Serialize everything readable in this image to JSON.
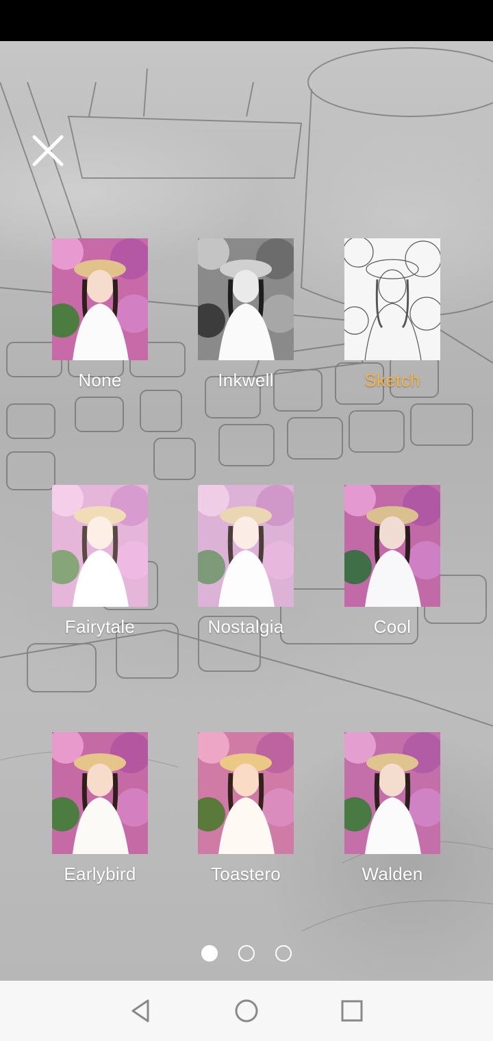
{
  "screen": {
    "close_icon": "close-icon",
    "selected_color": "#f4b541"
  },
  "filters": [
    {
      "label": "None",
      "style": "color",
      "selected": false
    },
    {
      "label": "Inkwell",
      "style": "bw",
      "selected": false
    },
    {
      "label": "Sketch",
      "style": "sketch",
      "selected": true
    },
    {
      "label": "Fairytale",
      "style": "soft",
      "selected": false
    },
    {
      "label": "Nostalgia",
      "style": "soft",
      "selected": false
    },
    {
      "label": "Cool",
      "style": "color",
      "selected": false
    },
    {
      "label": "Earlybird",
      "style": "color",
      "selected": false
    },
    {
      "label": "Toastero",
      "style": "warm",
      "selected": false
    },
    {
      "label": "Walden",
      "style": "color",
      "selected": false
    }
  ],
  "pager": {
    "pages": 3,
    "active_page": 1
  },
  "nav": {
    "back_icon": "back-triangle-icon",
    "home_icon": "home-circle-icon",
    "recents_icon": "recents-square-icon"
  }
}
